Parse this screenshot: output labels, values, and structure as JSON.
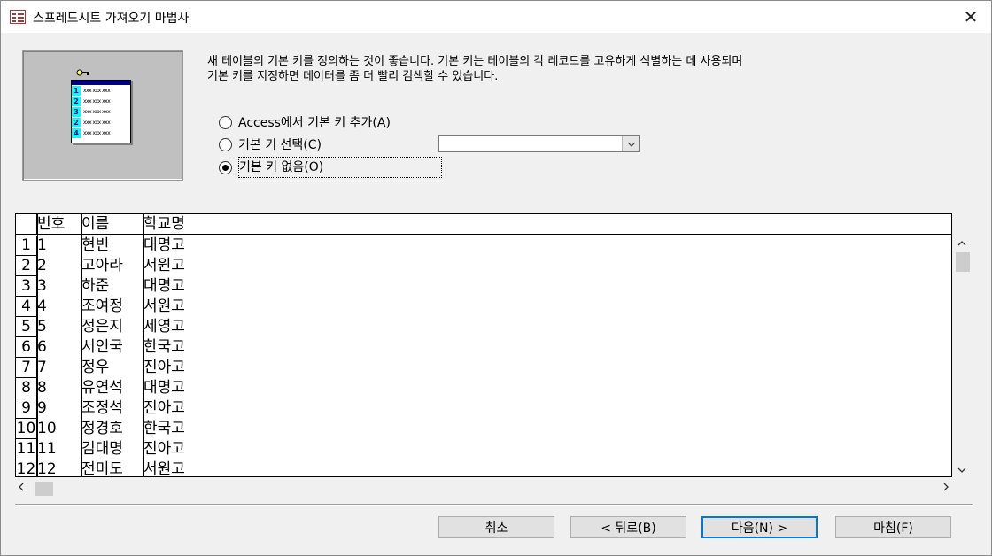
{
  "window": {
    "title": "스프레드시트 가져오기 마법사",
    "close_glyph": "✕"
  },
  "illustration": {
    "row_numbers": [
      "1",
      "2",
      "3",
      "2",
      "4"
    ],
    "row_text": "xxx xxx xxx"
  },
  "description": {
    "line1": "새 테이블의 기본 키를 정의하는 것이 좋습니다. 기본 키는 테이블의 각 레코드를 고유하게 식별하는 데 사용되며",
    "line2": "기본 키를 지정하면 데이터를 좀 더 빨리 검색할 수 있습니다."
  },
  "options": {
    "add_key": {
      "label": "Access에서 기본 키 추가(A)",
      "selected": false
    },
    "choose_key": {
      "label": "기본 키 선택(C)",
      "selected": false
    },
    "no_key": {
      "label": "기본 키 없음(O)",
      "selected": true
    },
    "key_dropdown_value": ""
  },
  "grid": {
    "columns": [
      "번호",
      "이름",
      "학교명"
    ],
    "rows": [
      {
        "rownum": "1",
        "no": "1",
        "name": "현빈",
        "school": "대명고"
      },
      {
        "rownum": "2",
        "no": "2",
        "name": "고아라",
        "school": "서원고"
      },
      {
        "rownum": "3",
        "no": "3",
        "name": "하준",
        "school": "대명고"
      },
      {
        "rownum": "4",
        "no": "4",
        "name": "조여정",
        "school": "서원고"
      },
      {
        "rownum": "5",
        "no": "5",
        "name": "정은지",
        "school": "세영고"
      },
      {
        "rownum": "6",
        "no": "6",
        "name": "서인국",
        "school": "한국고"
      },
      {
        "rownum": "7",
        "no": "7",
        "name": "정우",
        "school": "진아고"
      },
      {
        "rownum": "8",
        "no": "8",
        "name": "유연석",
        "school": "대명고"
      },
      {
        "rownum": "9",
        "no": "9",
        "name": "조정석",
        "school": "진아고"
      },
      {
        "rownum": "10",
        "no": "10",
        "name": "정경호",
        "school": "한국고"
      },
      {
        "rownum": "11",
        "no": "11",
        "name": "김대명",
        "school": "진아고"
      },
      {
        "rownum": "12",
        "no": "12",
        "name": "전미도",
        "school": "서원고"
      }
    ]
  },
  "buttons": {
    "cancel": "취소",
    "back": "< 뒤로(B)",
    "next": "다음(N) >",
    "finish": "마침(F)"
  }
}
